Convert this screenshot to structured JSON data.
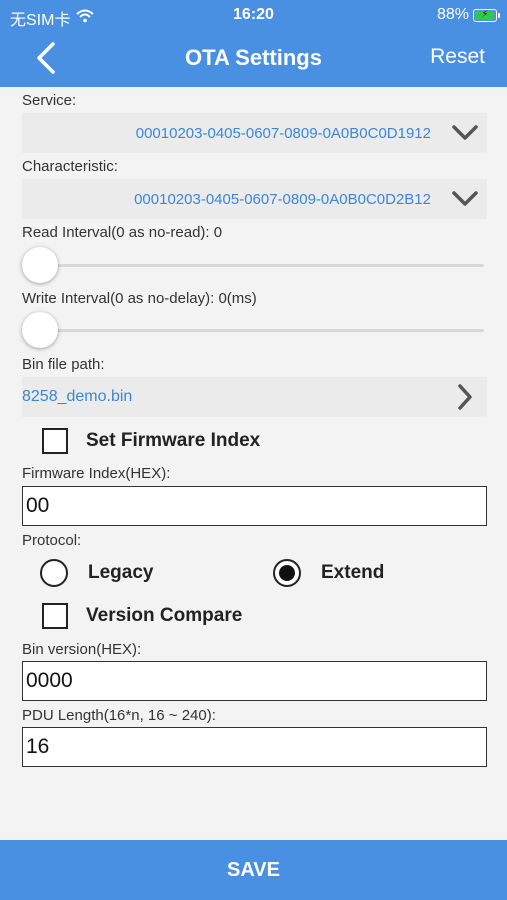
{
  "status_bar": {
    "carrier": "无SIM卡",
    "time": "16:20",
    "battery": "88%"
  },
  "navbar": {
    "title": "OTA Settings",
    "reset_label": "Reset"
  },
  "service": {
    "label": "Service:",
    "value": "00010203-0405-0607-0809-0A0B0C0D1912"
  },
  "characteristic": {
    "label": "Characteristic:",
    "value": "00010203-0405-0607-0809-0A0B0C0D2B12"
  },
  "read_interval": {
    "label": "Read Interval(0 as no-read): 0",
    "value": 0
  },
  "write_interval": {
    "label": "Write Interval(0 as no-delay): 0(ms)",
    "value": 0
  },
  "bin_file": {
    "label": "Bin file path:",
    "value": "8258_demo.bin"
  },
  "set_firmware_index": {
    "label": "Set Firmware Index",
    "checked": false
  },
  "firmware_index": {
    "label": "Firmware Index(HEX):",
    "value": "00"
  },
  "protocol": {
    "label": "Protocol:",
    "options": [
      "Legacy",
      "Extend"
    ],
    "selected": "Extend"
  },
  "version_compare": {
    "label": "Version Compare",
    "checked": false
  },
  "bin_version": {
    "label": "Bin version(HEX):",
    "value": "0000"
  },
  "pdu_length": {
    "label": "PDU Length(16*n, 16 ~ 240):",
    "value": "16"
  },
  "save_label": "SAVE",
  "colors": {
    "accent": "#4a90e2",
    "link": "#3a87d8"
  }
}
